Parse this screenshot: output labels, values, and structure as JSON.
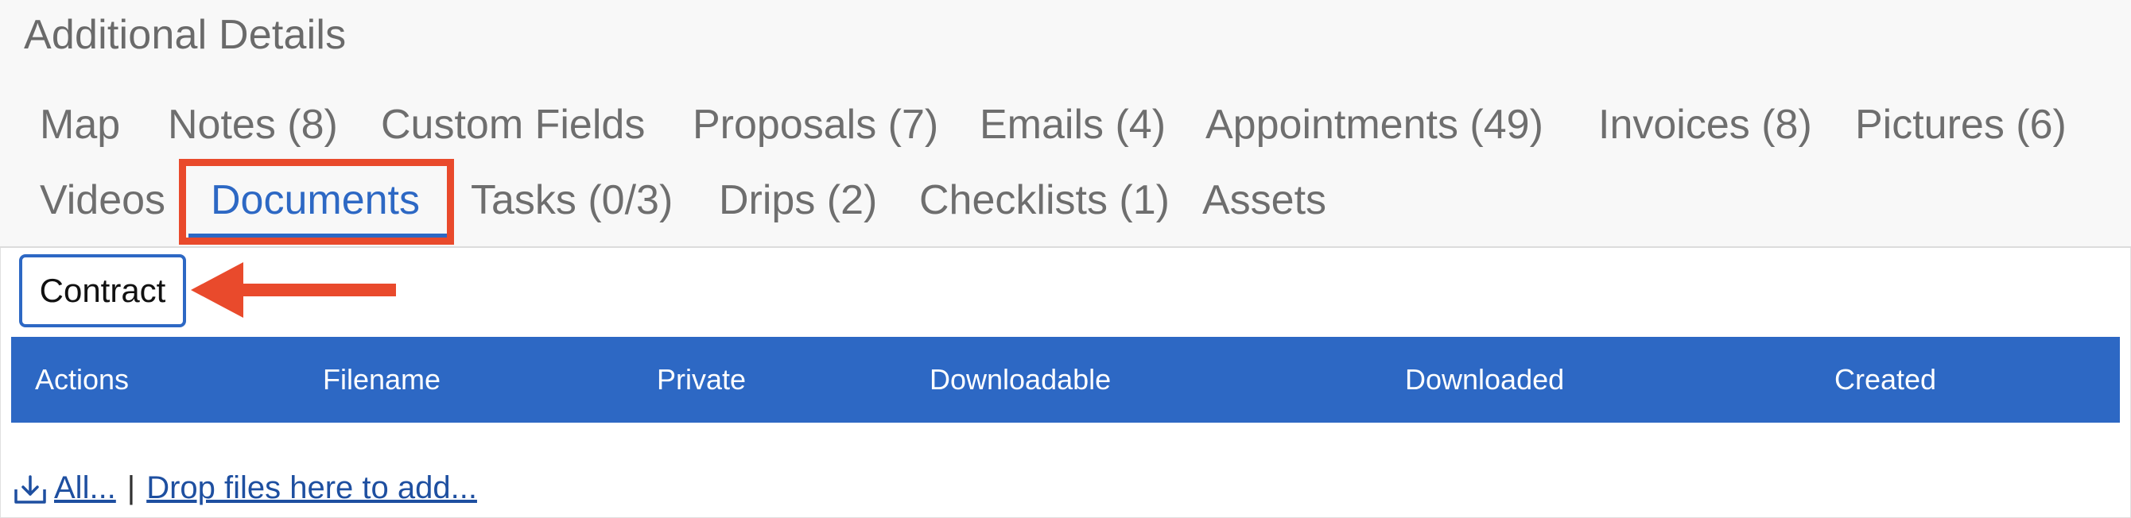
{
  "section": {
    "title": "Additional Details"
  },
  "tabs": [
    {
      "label": "Map"
    },
    {
      "label": "Notes (8)"
    },
    {
      "label": "Custom Fields"
    },
    {
      "label": "Proposals (7)"
    },
    {
      "label": "Emails (4)"
    },
    {
      "label": "Appointments (49)"
    },
    {
      "label": "Invoices (8)"
    },
    {
      "label": "Pictures (6)"
    },
    {
      "label": "Videos"
    },
    {
      "label": "Documents",
      "active": true
    },
    {
      "label": "Tasks (0/3)"
    },
    {
      "label": "Drips (2)"
    },
    {
      "label": "Checklists (1)"
    },
    {
      "label": "Assets"
    }
  ],
  "filter": {
    "contract_label": "Contract"
  },
  "table": {
    "columns": [
      "Actions",
      "Filename",
      "Private",
      "Downloadable",
      "Downloaded",
      "Created"
    ]
  },
  "footer": {
    "download_all_label": "All...",
    "separator": "|",
    "drop_label": "Drop files here to add..."
  },
  "colors": {
    "accent": "#2d68c4",
    "annotation": "#e94a2c",
    "link": "#1e4fa0"
  },
  "icons": {
    "download_all": "download-icon",
    "annotation_arrow": "arrow-left-icon"
  }
}
